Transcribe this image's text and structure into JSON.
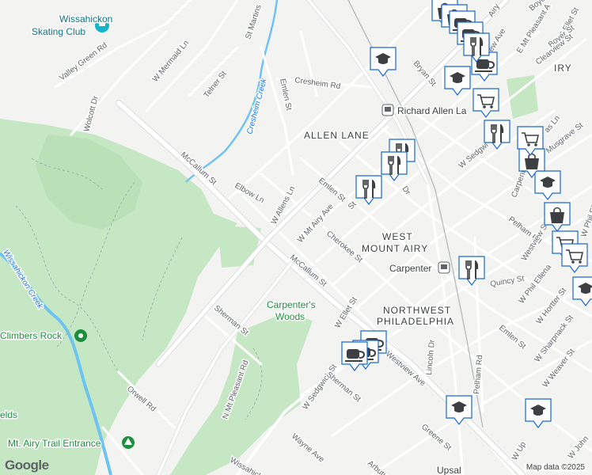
{
  "map": {
    "attribution": "Map data ©2025",
    "logo": "Google",
    "neighborhoods": [
      "ALLEN LANE",
      "WEST",
      "MOUNT AIRY",
      "NORTHWEST",
      "PHILADELPHIA"
    ],
    "places": {
      "skating_club": [
        "Wissahickon",
        "Skating Club"
      ],
      "climbers_rock": "Climbers Rock",
      "carpenters_woods": [
        "Carpenter's",
        "Woods"
      ],
      "trail_entrance": "Mt. Airy Trail Entrance",
      "fields": "elds",
      "allen_lane_station": "Richard Allen La",
      "carpenter_station": "Carpenter",
      "upsal": "Upsal"
    },
    "creeks": {
      "cresheim": "Cresheim Creek",
      "wissahickon": "Wissahickon Creek",
      "wissahick_bottom": "Wissahick"
    },
    "streets": {
      "valley_green": "Valley Green Rd",
      "w_mermaid": "W Mermaid Ln",
      "telner": "Telner St",
      "st_martins": "St Martins",
      "wolcott": "Wolcott Dr",
      "cresheim_rd": "Cresheim Rd",
      "emlen_top": "Emlen St",
      "bryan": "Bryan St",
      "mccallum_west": "McCallum St",
      "elbow": "Elbow Ln",
      "w_allens": "W Allens Ln",
      "emlen_mid": "Emlen St",
      "w_mt_airy": "W Mt Airy Ave",
      "st_frag": "St",
      "cherokee": "Cherokee St",
      "mccallum_east": "McCallum St",
      "sherman_west": "Sherman St",
      "w_ellet": "W Ellet St",
      "n_mt_pleasant": "N Mt Pleasant Rd",
      "orwell": "Orwell Rd",
      "w_sedgwick_bottom": "W Sedgwick St",
      "westview_ave": "Westview Ave",
      "sherman_east": "Sherman St",
      "lincoln": "Lincoln Dr",
      "pelham_bottom": "Pelham Rd",
      "greene": "Greene St",
      "wayne": "Wayne Ave",
      "arbutus": "Arbutus St",
      "carpenter_ln": "Carpenter Ln",
      "musgrave": "Musgrave St",
      "boyer_top": "Boyer St",
      "e_ellet": "E Ellet St",
      "e_mt_pleasant": "E Mt Pleasant A",
      "boyer_right": "Boyer St",
      "clearview": "Clearview St",
      "new_ave": "New Ave",
      "airy": "Airy",
      "w_sedgwick_top": "W Sedgwi",
      "gas_ln": "as Ln",
      "pelham_right": "Pelham Rd",
      "westview_right": "Westview St",
      "w_phil_ellena": "W Phil Ellena",
      "w_phil_elle2": "W Phil Elle",
      "quincy": "Quincy St",
      "w_hortter": "W Hortter St",
      "emlen_bottom": "Emlen St",
      "w_sharpnack": "W Sharpnack St",
      "w_weaver": "W Weaver St",
      "w_up": "W Up",
      "w_john": "W John",
      "dr_frag": "Dr",
      "iry": "IRY"
    },
    "markers": [
      {
        "icon": "school-icon",
        "count": 1
      },
      {
        "icon": "restaurant-icon",
        "count": 4
      },
      {
        "icon": "cafe-icon",
        "count": 3
      },
      {
        "icon": "shopping-icon",
        "count": 3
      },
      {
        "icon": "grocery-icon",
        "count": 3
      }
    ],
    "colors": {
      "park": "#c6e7c3",
      "park_dark": "#a8dab0",
      "water": "#6fc3f0",
      "road": "#ffffff",
      "road_edge": "#dadce0",
      "marker_blue": "#1967d2"
    }
  }
}
